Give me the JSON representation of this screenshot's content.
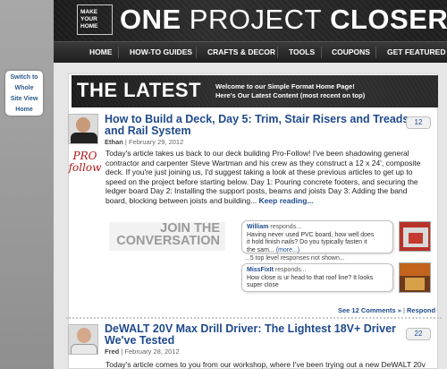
{
  "left_panel": {
    "switch_lines": [
      "Switch to",
      "Whole",
      "Site View",
      "Home"
    ]
  },
  "header": {
    "logo_lines": [
      "MAKE",
      "YOUR",
      "HOME"
    ],
    "title_part1": "ONE ",
    "title_part2": "PROJECT",
    "title_part3": " CLOSER",
    "nav": [
      "HOME",
      "HOW-TO GUIDES",
      "CRAFTS & DECOR",
      "TOOLS",
      "COUPONS",
      "GET FEATURED O"
    ]
  },
  "latest_bar": {
    "title": "THE LATEST",
    "sub_line1": "Welcome to our Simple Format Home Page!",
    "sub_line2": "Here's Our Latest Content (most recent on top)"
  },
  "posts": [
    {
      "title_lines": [
        "How to Build a Deck, Day 5: Trim, Stair Risers and Treads,",
        "and Rail System"
      ],
      "author": "Ethan",
      "date": "February 29, 2012",
      "comment_count": "12",
      "badge_lines": [
        "PRO",
        "follow"
      ],
      "excerpt_lines": [
        "Today's article takes us back to our deck building Pro-Follow! I've been shadowing general",
        "contractor and carpenter Steve Wartman and his crew as they construct a 12 x 24', composite",
        "deck. If you're just joining us, I'd suggest taking a look at these previous articles to get up to",
        "speed on the project before starting below. Day 1: Pouring concrete footers, and securing the",
        "ledger board Day 2: Installing the support posts, beams and joists Day 3: Adding the band",
        "board, blocking between joists and building..."
      ],
      "keep_reading": "Keep reading...",
      "join_lines": [
        "JOIN THE",
        "CONVERSATION"
      ],
      "comments": [
        {
          "name": "William",
          "action": "responds...",
          "lines": [
            "Having never used PVC board, how well does",
            "it hold finish nails? Do you typically fasten it",
            "the sam..."
          ],
          "more": "(more...)"
        },
        {
          "name": "MissFixIt",
          "action": "responds...",
          "lines": [
            "How close is ur head to that roof line? It looks",
            "super close"
          ],
          "more": ""
        }
      ],
      "shown_note": "...5 top level responses not shown...",
      "see_comments": "See 12 Comments »",
      "respond": "Respond"
    },
    {
      "title_lines": [
        "DeWALT 20V Max Drill Driver: The Lightest 18V+ Driver",
        "We've Tested"
      ],
      "author": "Fred",
      "date": "February 28, 2012",
      "comment_count": "22",
      "excerpt_first": "Today's article comes to you from our workshop, where I've been trying out a new DeWALT 20v"
    }
  ],
  "colors": {
    "link_blue": "#1f4a8c",
    "pro_red": "#b01818"
  }
}
